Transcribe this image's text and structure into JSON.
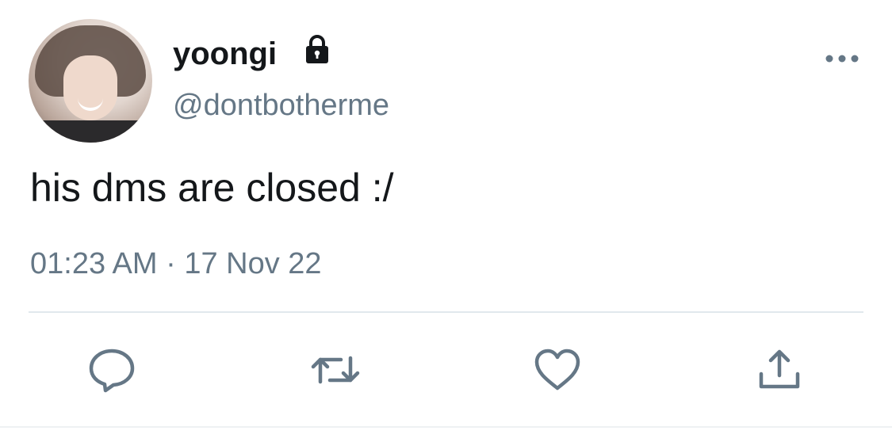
{
  "user": {
    "display_name": "yoongi",
    "handle": "@dontbotherme",
    "protected_icon": "lock-icon",
    "avatar_icon": "profile-photo"
  },
  "tweet": {
    "text": "his dms are closed :/",
    "timestamp": "01:23 AM · 17 Nov 22"
  },
  "actions": {
    "reply_icon": "speech-bubble-icon",
    "retweet_icon": "retweet-icon",
    "like_icon": "heart-icon",
    "share_icon": "share-upload-icon",
    "more_icon": "more-dots-icon"
  },
  "colors": {
    "primary_text": "#14171a",
    "secondary_text": "#657786",
    "icon": "#657786",
    "divider": "#e1e8ed"
  }
}
